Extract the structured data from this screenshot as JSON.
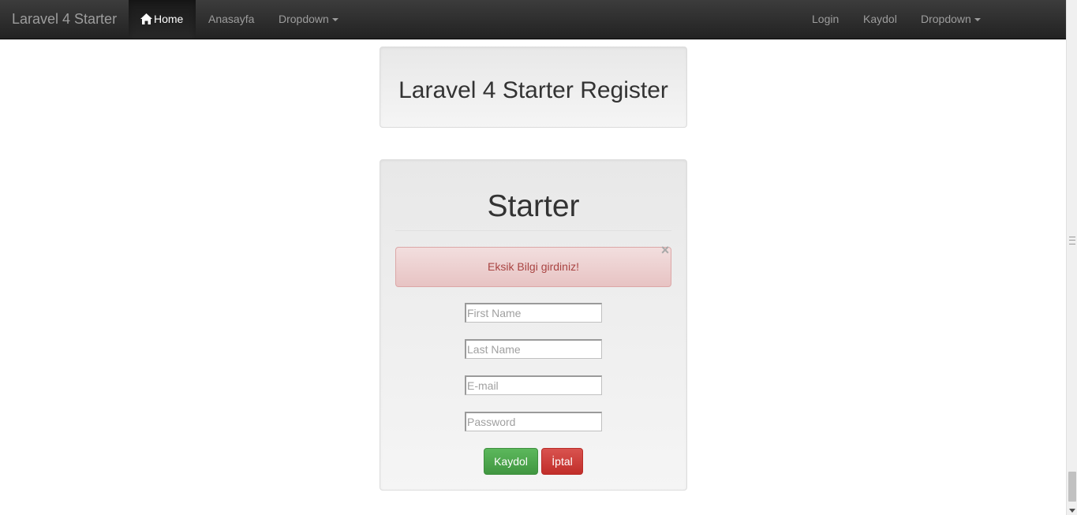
{
  "navbar": {
    "brand": "Laravel 4 Starter",
    "left_items": [
      {
        "label": "Home",
        "icon": "home-icon",
        "active": true
      },
      {
        "label": "Anasayfa"
      },
      {
        "label": "Dropdown",
        "dropdown": true
      }
    ],
    "right_items": [
      {
        "label": "Login"
      },
      {
        "label": "Kaydol"
      },
      {
        "label": "Dropdown",
        "dropdown": true
      }
    ]
  },
  "page": {
    "title": "Laravel 4 Starter Register"
  },
  "form": {
    "heading": "Starter",
    "alert": {
      "message": "Eksik Bilgi girdiniz!",
      "close_symbol": "×"
    },
    "fields": {
      "first_name": {
        "placeholder": "First Name",
        "value": ""
      },
      "last_name": {
        "placeholder": "Last Name",
        "value": ""
      },
      "email": {
        "placeholder": "E-mail",
        "value": ""
      },
      "password": {
        "placeholder": "Password",
        "value": ""
      }
    },
    "submit_label": "Kaydol",
    "cancel_label": "İptal"
  },
  "colors": {
    "navbar_bg": "#222222",
    "alert_text": "#a94442",
    "success": "#5cb85c",
    "danger": "#d9534f"
  }
}
